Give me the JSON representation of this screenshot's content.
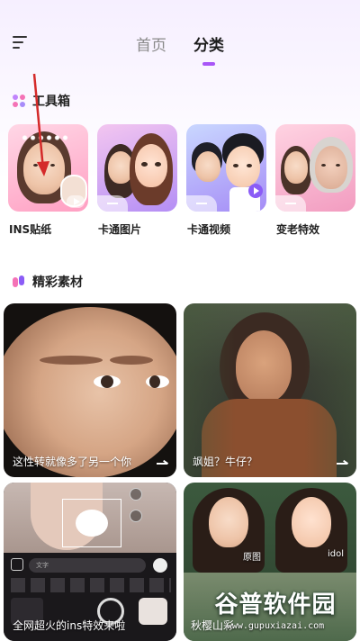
{
  "header": {
    "tabs": [
      {
        "label": "首页",
        "active": false
      },
      {
        "label": "分类",
        "active": true
      }
    ]
  },
  "tools_section": {
    "title": "工具箱",
    "items": [
      {
        "label": "INS贴纸"
      },
      {
        "label": "卡通图片"
      },
      {
        "label": "卡通视频"
      },
      {
        "label": "变老特效"
      }
    ]
  },
  "materials_section": {
    "title": "精彩素材",
    "items": [
      {
        "caption": "这性转就像多了另一个你"
      },
      {
        "caption": "飒姐？牛仔？"
      },
      {
        "caption": "全网超火的ins特效来啦"
      },
      {
        "caption": "秋樱山彩"
      }
    ],
    "overlay_labels": {
      "search_placeholder": "文字",
      "before": "原图",
      "after": "idol"
    }
  },
  "watermark": {
    "title": "谷普软件园",
    "url": "www.gupuxiazai.com"
  },
  "colors": {
    "accent": "#a855f7",
    "annotation_arrow": "#d42a2a"
  }
}
